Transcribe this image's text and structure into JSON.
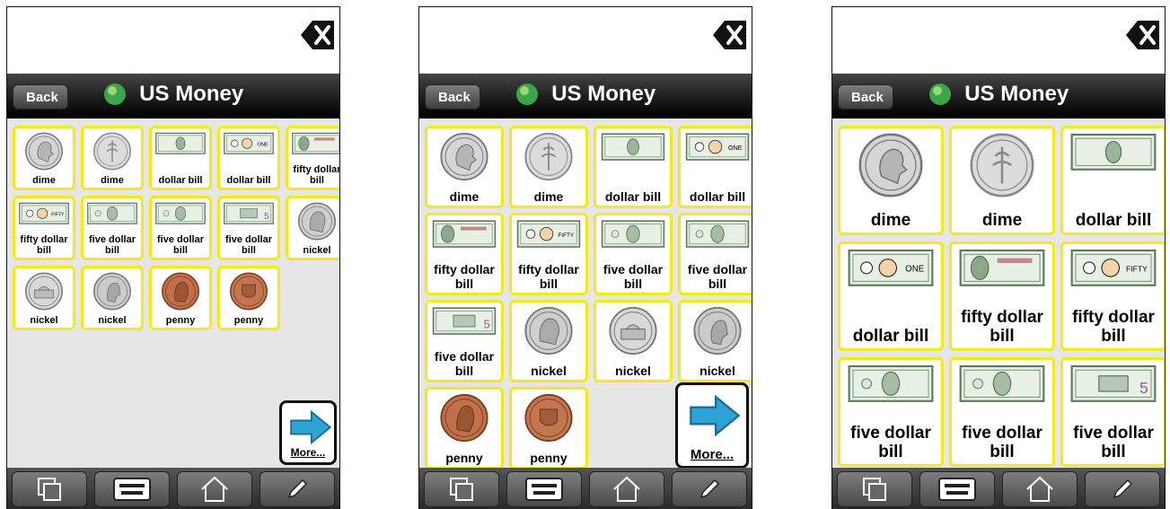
{
  "screens": [
    {
      "app": {
        "back_label": "Back",
        "title": "US Money"
      },
      "items": [
        "dime",
        "dime",
        "dollar bill",
        "dollar bill",
        "fifty dollar bill",
        "fifty dollar bill",
        "five dollar bill",
        "five dollar bill",
        "five dollar bill",
        "nickel",
        "nickel",
        "nickel",
        "penny",
        "penny"
      ],
      "more_label": "More..."
    },
    {
      "app": {
        "back_label": "Back",
        "title": "US Money"
      },
      "items": [
        "dime",
        "dime",
        "dollar bill",
        "dollar bill",
        "fifty dollar bill",
        "fifty dollar bill",
        "five dollar bill",
        "five dollar bill",
        "five dollar bill",
        "nickel",
        "nickel",
        "nickel",
        "penny",
        "penny"
      ],
      "more_label": "More..."
    },
    {
      "app": {
        "back_label": "Back",
        "title": "US Money"
      },
      "items": [
        "dime",
        "dime",
        "dollar bill",
        "dollar bill",
        "fifty dollar bill",
        "fifty dollar bill",
        "five dollar bill",
        "five dollar bill",
        "five dollar bill"
      ]
    }
  ],
  "item_images": [
    "dime-heads",
    "dime-tails",
    "one-dollar-bill",
    "cartoon-dollar-bill",
    "fifty-dollar-bill",
    "cartoon-fifty-bill",
    "five-dollar-bill-front",
    "five-dollar-bill-front",
    "five-dollar-bill-back",
    "nickel-jefferson-front",
    "nickel-monticello",
    "nickel-jefferson-profile",
    "penny-lincoln",
    "penny-shield"
  ],
  "colors": {
    "cell_border": "#f3e91b",
    "navbar": "#1c1c1c",
    "more_arrow": "#2ea3d6"
  },
  "toolbar_icons": [
    "pages-icon",
    "keyboard-icon",
    "home-icon",
    "pencil-icon"
  ]
}
